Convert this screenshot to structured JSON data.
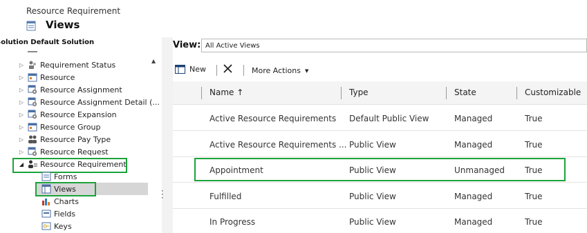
{
  "header": {
    "breadcrumb": "Resource Requirement",
    "title": "Views",
    "title_icon": "views-grid-icon"
  },
  "sidebar": {
    "solution_title": "Solution Default Solution",
    "items": [
      {
        "label": "Requirement Status",
        "icon": "status-users-icon",
        "expanded": false
      },
      {
        "label": "Resource",
        "icon": "entity-icon",
        "expanded": false
      },
      {
        "label": "Resource Assignment",
        "icon": "entity-gear-icon",
        "expanded": false
      },
      {
        "label": "Resource Assignment Detail (...",
        "icon": "entity-gear-icon",
        "expanded": false
      },
      {
        "label": "Resource Expansion",
        "icon": "entity-gear-icon",
        "expanded": false
      },
      {
        "label": "Resource Group",
        "icon": "entity-icon",
        "expanded": false
      },
      {
        "label": "Resource Pay Type",
        "icon": "users-icon",
        "expanded": false
      },
      {
        "label": "Resource Request",
        "icon": "entity-gear-icon",
        "expanded": false
      },
      {
        "label": "Resource Requirement",
        "icon": "person-list-icon",
        "expanded": true
      }
    ],
    "children": [
      {
        "label": "Forms",
        "icon": "form-icon"
      },
      {
        "label": "Views",
        "icon": "views-grid-icon",
        "selected": true
      },
      {
        "label": "Charts",
        "icon": "bar-chart-icon"
      },
      {
        "label": "Fields",
        "icon": "fields-icon"
      },
      {
        "label": "Keys",
        "icon": "key-icon"
      }
    ]
  },
  "view_selector": {
    "label": "View:",
    "value": "All Active Views"
  },
  "toolbar": {
    "new_label": "New",
    "delete_icon": "delete-x-icon",
    "more_actions_label": "More Actions"
  },
  "grid": {
    "columns": [
      "Name ↑",
      "Type",
      "State",
      "Customizable"
    ],
    "rows": [
      {
        "name": "Active Resource Requirements",
        "type": "Default Public View",
        "state": "Managed",
        "customizable": "True"
      },
      {
        "name": "Active Resource Requirements ...",
        "type": "Public View",
        "state": "Managed",
        "customizable": "True"
      },
      {
        "name": "Appointment",
        "type": "Public View",
        "state": "Unmanaged",
        "customizable": "True"
      },
      {
        "name": "Fulfilled",
        "type": "Public View",
        "state": "Managed",
        "customizable": "True"
      },
      {
        "name": "In Progress",
        "type": "Public View",
        "state": "Managed",
        "customizable": "True"
      }
    ]
  },
  "colors": {
    "highlight": "#1aa33a",
    "selected_bg": "#d6d6d6"
  }
}
